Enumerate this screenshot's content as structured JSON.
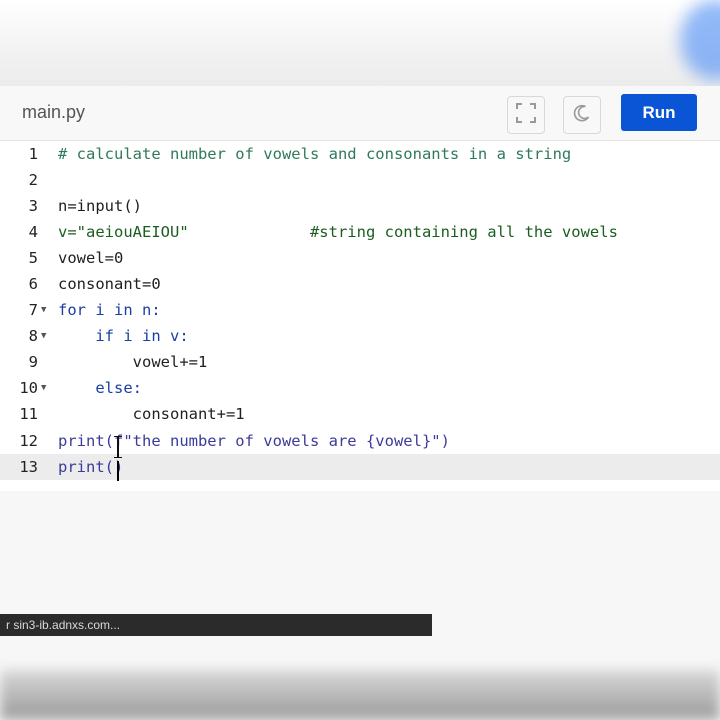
{
  "editor": {
    "filename": "main.py",
    "run_label": "Run",
    "icons": {
      "fullscreen": "fullscreen-icon",
      "theme": "moon-icon"
    },
    "accent_color": "#0a55d6"
  },
  "code_lines": [
    {
      "num": "1",
      "text": "# calculate number of vowels and consonants in a string"
    },
    {
      "num": "2",
      "text": ""
    },
    {
      "num": "3",
      "text": "n=input()"
    },
    {
      "num": "4",
      "text": "v=\"aeiouAEIOU\"             #string containing all the vowels"
    },
    {
      "num": "5",
      "text": "vowel=0"
    },
    {
      "num": "6",
      "text": "consonant=0"
    },
    {
      "num": "7",
      "text": "for i in n:"
    },
    {
      "num": "8",
      "text": "    if i in v:"
    },
    {
      "num": "9",
      "text": "        vowel+=1"
    },
    {
      "num": "10",
      "text": "    else:"
    },
    {
      "num": "11",
      "text": "        consonant+=1"
    },
    {
      "num": "12",
      "text": "print(f\"the number of vowels are {vowel}\")"
    },
    {
      "num": "13",
      "text": "print()"
    }
  ],
  "fold_lines": [
    "7",
    "8",
    "10"
  ],
  "status": {
    "text": "r sin3-ib.adnxs.com..."
  }
}
